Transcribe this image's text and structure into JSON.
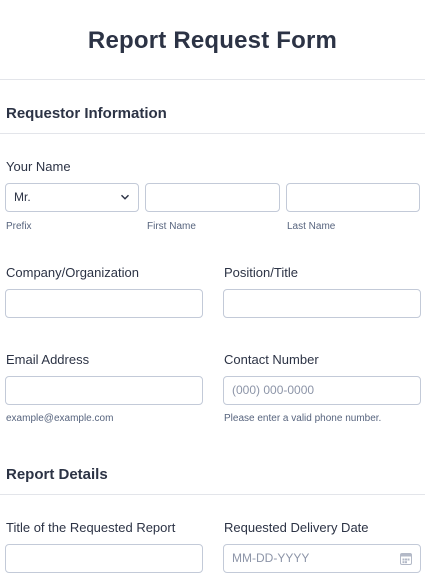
{
  "form": {
    "title": "Report Request Form"
  },
  "sections": {
    "requestor": "Requestor Information",
    "report": "Report Details"
  },
  "fields": {
    "your_name": {
      "label": "Your Name",
      "prefix_value": "Mr.",
      "prefix_sub": "Prefix",
      "first_sub": "First Name",
      "last_sub": "Last Name"
    },
    "company": {
      "label": "Company/Organization"
    },
    "position": {
      "label": "Position/Title"
    },
    "email": {
      "label": "Email Address",
      "sub": "example@example.com"
    },
    "contact": {
      "label": "Contact Number",
      "placeholder": "(000) 000-0000",
      "sub": "Please enter a valid phone number."
    },
    "report_title": {
      "label": "Title of the Requested Report"
    },
    "delivery_date": {
      "label": "Requested Delivery Date",
      "placeholder": "MM-DD-YYYY"
    }
  },
  "icons": {
    "prefix_dropdown": "chevron-down-icon",
    "date_picker": "calendar-icon"
  }
}
